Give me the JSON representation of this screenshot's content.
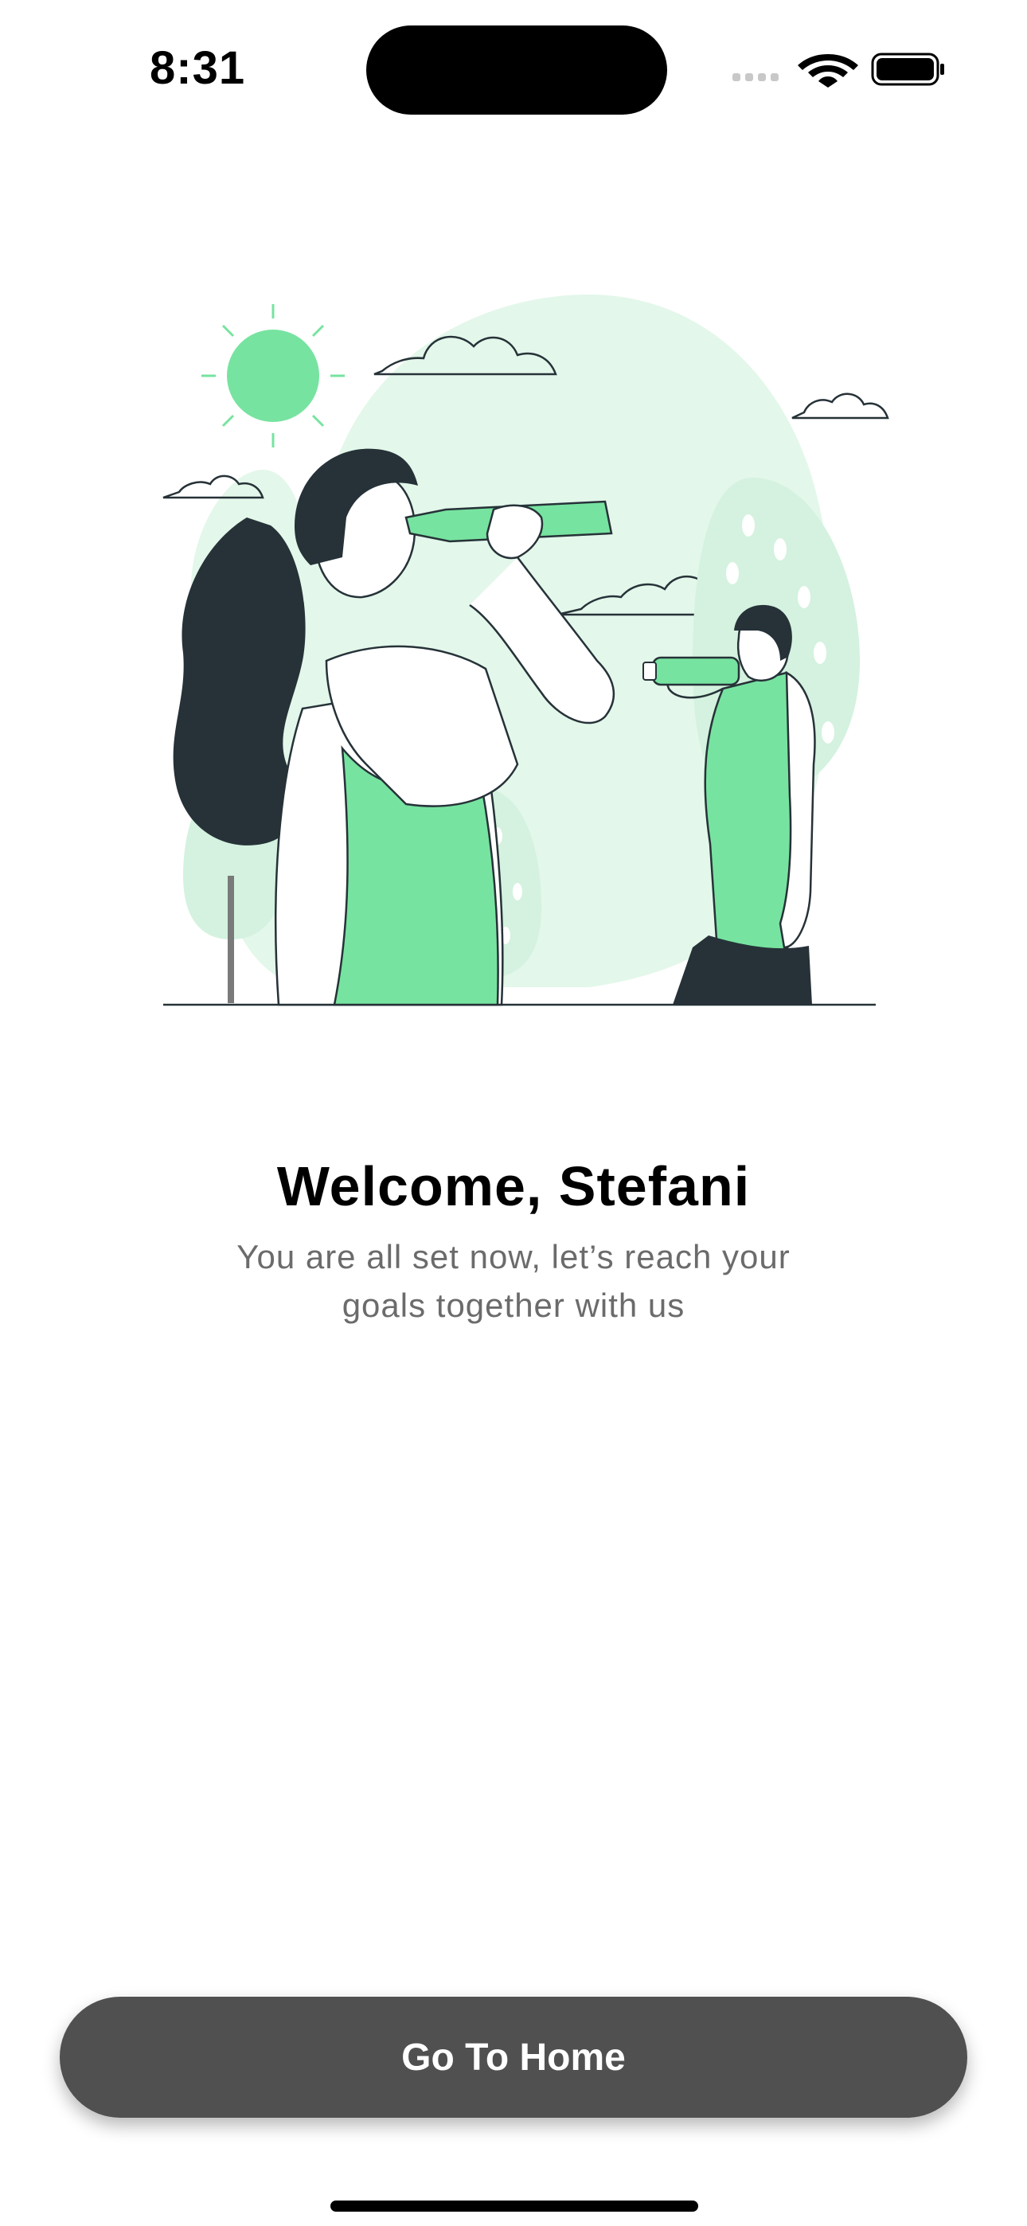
{
  "status_bar": {
    "time": "8:31"
  },
  "illustration": {
    "icon": "people-drinking-water-illustration",
    "accent_color": "#77E3A0",
    "light_accent_color": "#E3F7EA",
    "dark_color": "#263238"
  },
  "welcome": {
    "title": "Welcome, Stefani",
    "subtitle": "You are all set now, let’s reach your goals together with us"
  },
  "actions": {
    "home_button_label": "Go To Home"
  },
  "colors": {
    "button_bg": "#505050",
    "subtitle_text": "#6b6b6b"
  }
}
